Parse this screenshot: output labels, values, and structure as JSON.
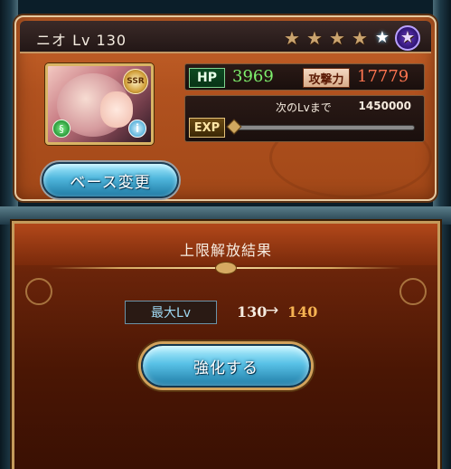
{
  "character": {
    "name_level": "ニオ Lv 130",
    "stars": {
      "gold": 4,
      "white": 1,
      "purple": 1
    },
    "rarity_badge": "SSR",
    "element": "wind",
    "hp_label": "HP",
    "hp": "3969",
    "atk_label": "攻撃力",
    "atk": "17779",
    "exp_label": "EXP",
    "exp_next_label": "次のLvまで",
    "exp_next_value": "1450000",
    "exp_progress": 0.0,
    "base_change_label": "ベース変更"
  },
  "result": {
    "title": "上限解放結果",
    "max_lv_label": "最大Lv",
    "lv_from": "130",
    "arrow": "→",
    "lv_to": "140",
    "enhance_label": "強化する"
  },
  "colors": {
    "hp": "#7ef06d",
    "atk": "#ff7550",
    "lv_to": "#f6b352",
    "accent_button": "#58c1e6"
  },
  "icons": {
    "star": "star-icon",
    "element": "wind-element-icon",
    "info": "info-icon"
  }
}
